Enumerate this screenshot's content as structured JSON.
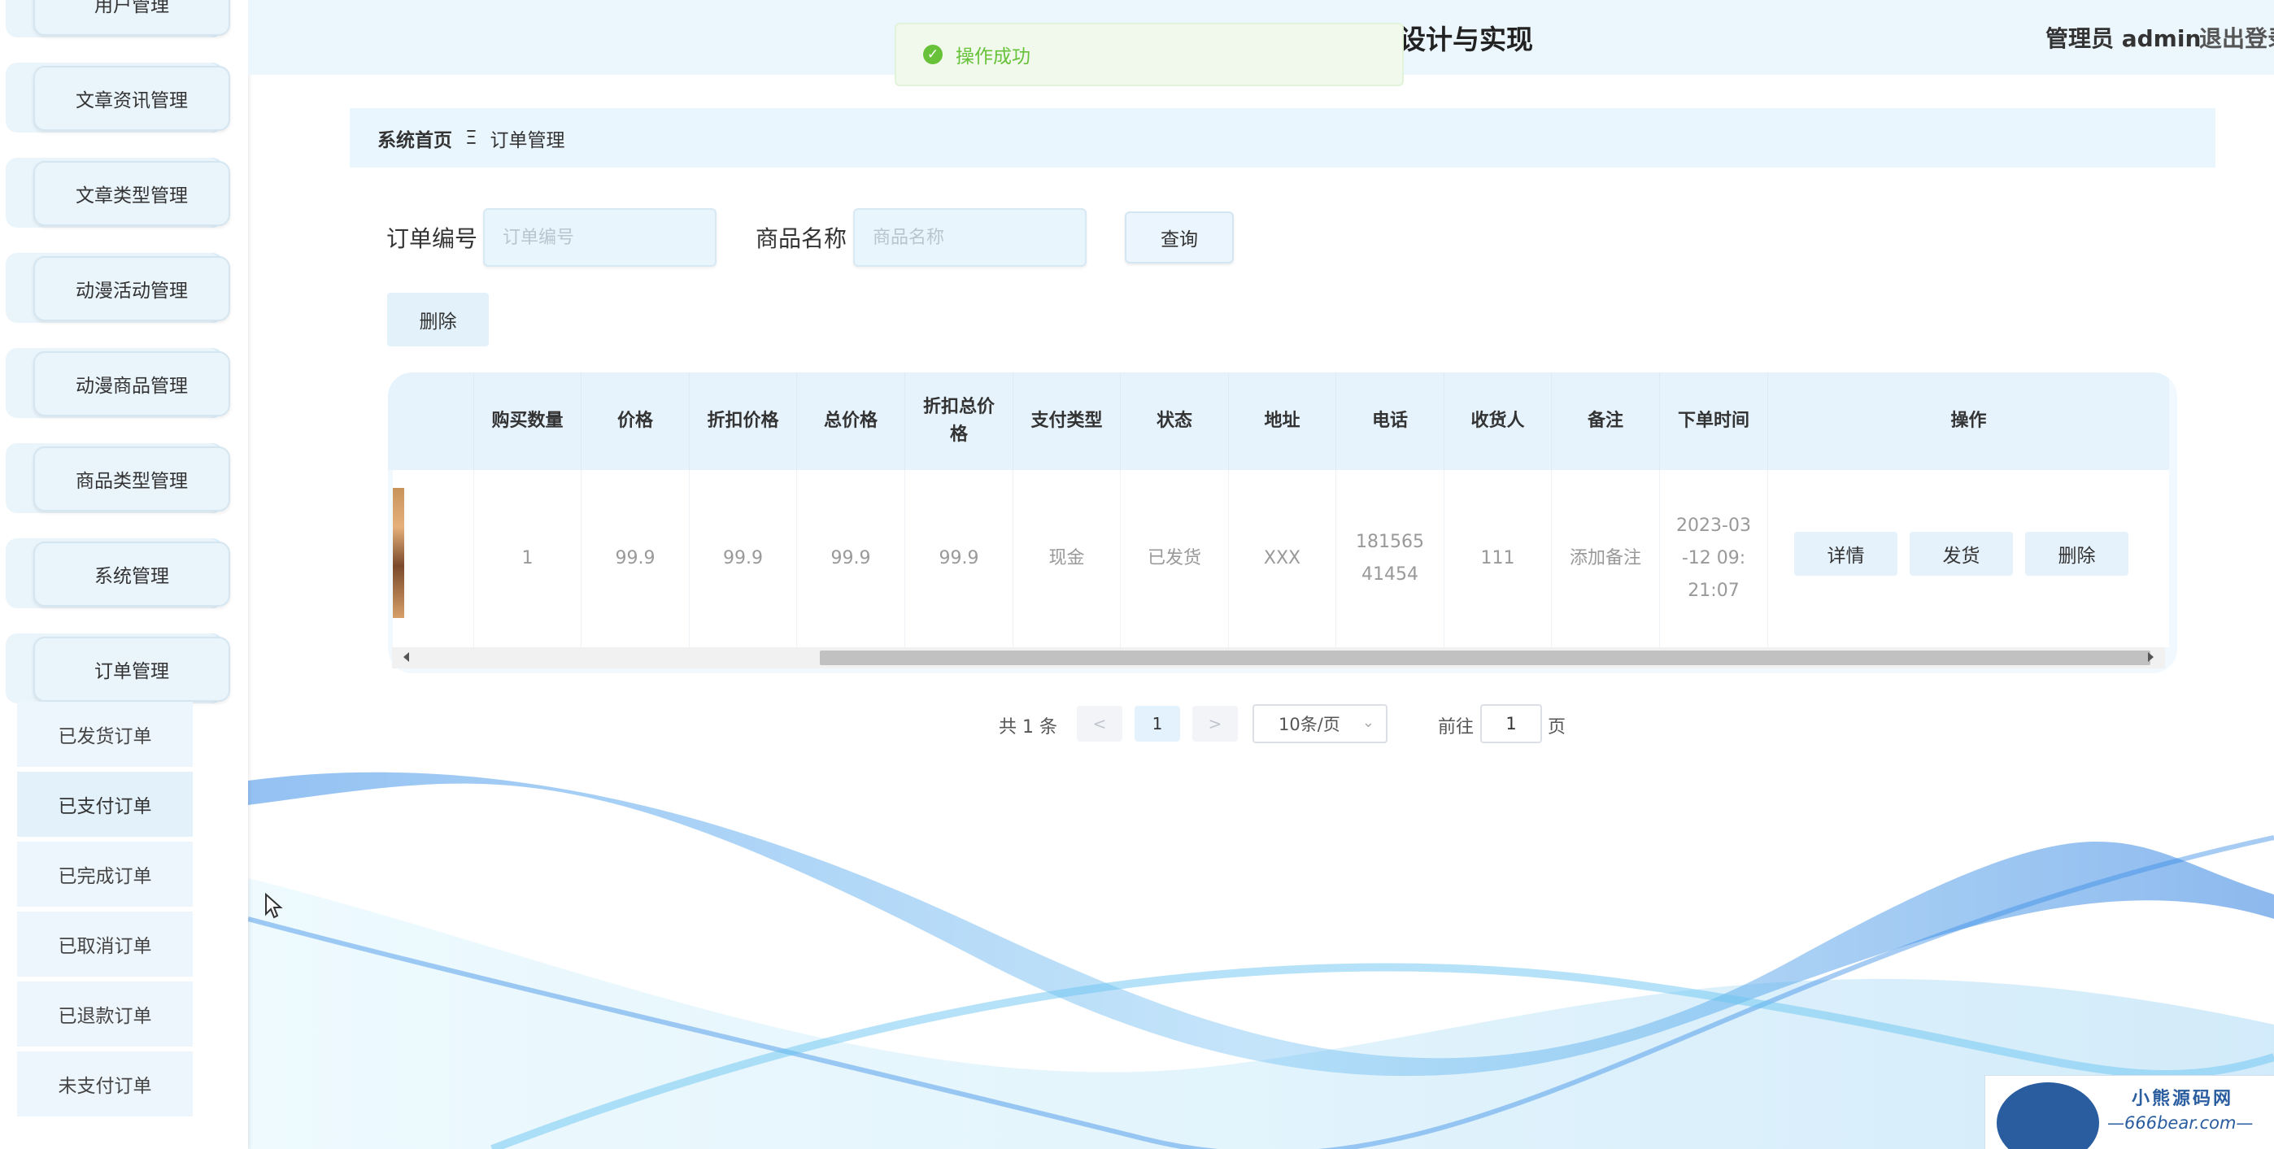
{
  "header": {
    "title": "设计与实现",
    "user_label": "管理员 admin",
    "logout_label": "退出登录"
  },
  "toast": {
    "message": "操作成功"
  },
  "sidebar": {
    "menu": [
      {
        "label": "用户管理"
      },
      {
        "label": "文章资讯管理"
      },
      {
        "label": "文章类型管理"
      },
      {
        "label": "动漫活动管理"
      },
      {
        "label": "动漫商品管理"
      },
      {
        "label": "商品类型管理"
      },
      {
        "label": "系统管理"
      },
      {
        "label": "订单管理"
      }
    ],
    "submenu": [
      {
        "label": "已发货订单"
      },
      {
        "label": "已支付订单"
      },
      {
        "label": "已完成订单"
      },
      {
        "label": "已取消订单"
      },
      {
        "label": "已退款订单"
      },
      {
        "label": "未支付订单"
      }
    ]
  },
  "breadcrumb": {
    "home": "系统首页",
    "separator": "Ξ",
    "current": "订单管理"
  },
  "search": {
    "order_no_label": "订单编号",
    "order_no_placeholder": "订单编号",
    "product_label": "商品名称",
    "product_placeholder": "商品名称",
    "query_label": "查询",
    "delete_label": "删除"
  },
  "table": {
    "headers": [
      "购买数量",
      "价格",
      "折扣价格",
      "总价格",
      "折扣总价格",
      "支付类型",
      "状态",
      "地址",
      "电话",
      "收货人",
      "备注",
      "下单时间",
      "操作"
    ],
    "row": {
      "quantity": "1",
      "price": "99.9",
      "discount_price": "99.9",
      "total_price": "99.9",
      "discount_total": "99.9",
      "pay_type": "现金",
      "status": "已发货",
      "address": "XXX",
      "phone": "18156541454",
      "receiver": "111",
      "remark": "添加备注",
      "order_time": "2023-03-12 09:21:07"
    },
    "actions": {
      "detail": "详情",
      "ship": "发货",
      "delete": "删除"
    }
  },
  "pagination": {
    "total": "共 1 条",
    "prev": "<",
    "current_page": "1",
    "next": ">",
    "page_size": "10条/页",
    "goto_label": "前往",
    "goto_value": "1",
    "page_suffix": "页"
  },
  "watermark": {
    "line1": "小熊源码网",
    "line2": "—666bear.com—"
  }
}
